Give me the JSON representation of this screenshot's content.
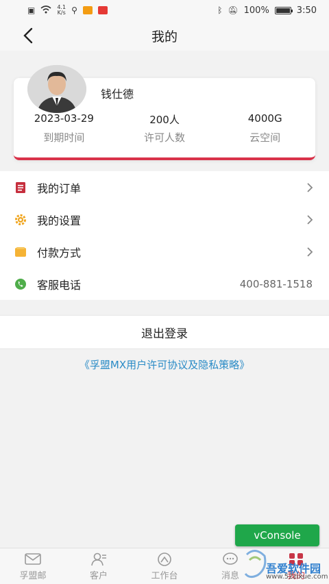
{
  "status_bar": {
    "net_speed_top": "4.1",
    "net_speed_bottom": "K/s",
    "battery": "100%",
    "time": "3:50"
  },
  "nav": {
    "title": "我的"
  },
  "profile": {
    "name": "钱仕德",
    "stats": [
      {
        "value": "2023-03-29",
        "label": "到期时间"
      },
      {
        "value": "200人",
        "label": "许可人数"
      },
      {
        "value": "4000G",
        "label": "云空间"
      }
    ]
  },
  "menu": {
    "orders": "我的订单",
    "settings": "我的设置",
    "payment": "付款方式",
    "service": "客服电话",
    "service_phone": "400-881-1518"
  },
  "logout": "退出登录",
  "agreement": "《孚盟MX用户许可协议及隐私策略》",
  "vconsole": "vConsole",
  "tabs": [
    "孚盟邮",
    "客户",
    "工作台",
    "消息",
    "我的"
  ],
  "watermark": {
    "line1": "吾爱软件园",
    "line2": "www.52zixue.com"
  },
  "colors": {
    "accent": "#d9324a",
    "link": "#2a8bc6",
    "vconsole": "#1fa74a"
  }
}
